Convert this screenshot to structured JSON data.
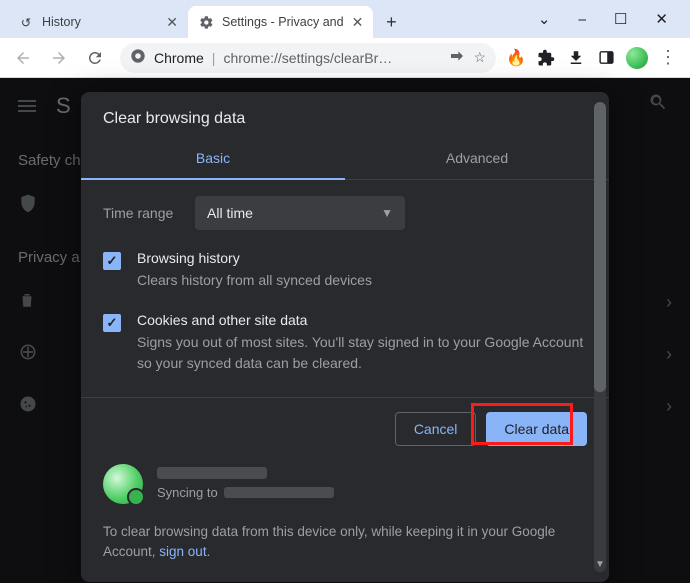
{
  "window": {
    "min": "⎯",
    "max": "☐",
    "close": "✕",
    "drop": "⌄"
  },
  "tabs": {
    "history": {
      "title": "History",
      "icon": "↺"
    },
    "settings": {
      "title": "Settings - Privacy and"
    },
    "newtab": "+"
  },
  "toolbar": {
    "chrome_label": "Chrome",
    "url": "chrome://settings/clearBr…"
  },
  "backdrop": {
    "title_char": "S",
    "section1": "Safety ch",
    "section2": "Privacy a"
  },
  "dialog": {
    "title": "Clear browsing data",
    "tab_basic": "Basic",
    "tab_advanced": "Advanced",
    "time_range_label": "Time range",
    "time_range_value": "All time",
    "opt1": {
      "title": "Browsing history",
      "desc": "Clears history from all synced devices"
    },
    "opt2": {
      "title": "Cookies and other site data",
      "desc": "Signs you out of most sites. You'll stay signed in to your Google Account so your synced data can be cleared."
    },
    "cancel": "Cancel",
    "clear": "Clear data",
    "syncing_to": "Syncing to",
    "footer_text": "To clear browsing data from this device only, while keeping it in your Google Account, ",
    "footer_link": "sign out"
  }
}
